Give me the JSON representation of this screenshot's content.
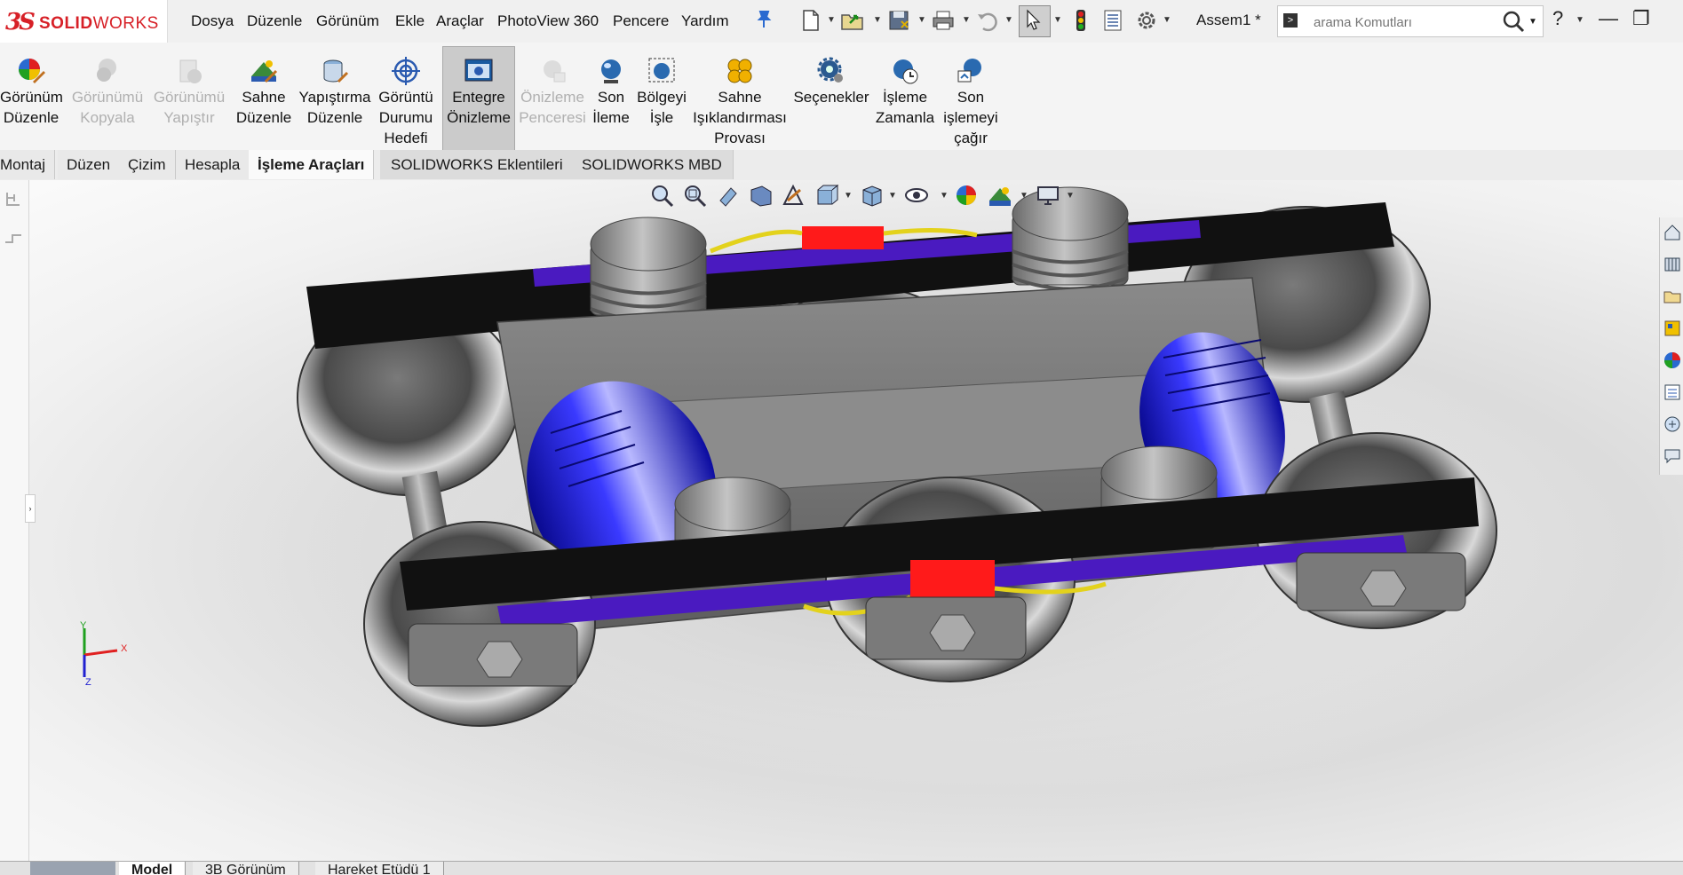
{
  "app": {
    "logo_mark": "3S",
    "logo_text_bold": "SOLID",
    "logo_text_light": "WORKS",
    "document_title": "Assem1 *"
  },
  "menu": [
    "Dosya",
    "Düzenle",
    "Görünüm",
    "Ekle",
    "Araçlar",
    "PhotoView 360",
    "Pencere",
    "Yardım"
  ],
  "search": {
    "placeholder": "arama Komutları",
    "prompt_glyph": ">"
  },
  "window_controls": {
    "help": "?",
    "minimize": "—",
    "restore": "❐",
    "close": "✕"
  },
  "ribbon": [
    {
      "label": "Görünüm Düzenle",
      "lines": [
        "Görünüm",
        "Düzenle"
      ],
      "enabled": true,
      "icon": "edit-appearance-icon"
    },
    {
      "label": "Görünümü Kopyala",
      "lines": [
        "Görünümü",
        "Kopyala"
      ],
      "enabled": false,
      "icon": "copy-appearance-icon"
    },
    {
      "label": "Görünümü Yapıştır",
      "lines": [
        "Görünümü",
        "Yapıştır"
      ],
      "enabled": false,
      "icon": "paste-appearance-icon"
    },
    {
      "label": "Sahne Düzenle",
      "lines": [
        "Sahne",
        "Düzenle"
      ],
      "enabled": true,
      "icon": "edit-scene-icon"
    },
    {
      "label": "Yapıştırma Düzenle",
      "lines": [
        "Yapıştırma",
        "Düzenle"
      ],
      "enabled": true,
      "icon": "edit-decal-icon"
    },
    {
      "label": "Görüntü Durumu Hedefi",
      "lines": [
        "Görüntü",
        "Durumu",
        "Hedefi"
      ],
      "enabled": true,
      "icon": "display-state-target-icon"
    },
    {
      "label": "Entegre Önizleme",
      "lines": [
        "Entegre",
        "Önizleme"
      ],
      "enabled": true,
      "active": true,
      "icon": "integrated-preview-icon"
    },
    {
      "label": "Önizleme Penceresi",
      "lines": [
        "Önizleme",
        "Penceresi"
      ],
      "enabled": false,
      "icon": "preview-window-icon"
    },
    {
      "label": "Son İleme",
      "lines": [
        "Son",
        "İleme"
      ],
      "enabled": true,
      "icon": "final-render-icon"
    },
    {
      "label": "Bölgeyi İşle",
      "lines": [
        "Bölgeyi",
        "İşle"
      ],
      "enabled": true,
      "icon": "render-region-icon"
    },
    {
      "label": "Sahne Işıklandırması Provası",
      "lines": [
        "Sahne",
        "Işıklandırması",
        "Provası"
      ],
      "enabled": true,
      "icon": "scene-lighting-proof-icon"
    },
    {
      "label": "Seçenekler",
      "lines": [
        "Seçenekler"
      ],
      "enabled": true,
      "icon": "options-icon"
    },
    {
      "label": "İşleme Zamanla",
      "lines": [
        "İşleme",
        "Zamanla"
      ],
      "enabled": true,
      "icon": "schedule-render-icon"
    },
    {
      "label": "Son işlemeyi çağır",
      "lines": [
        "Son",
        "işlemeyi",
        "çağır"
      ],
      "enabled": true,
      "icon": "recall-last-render-icon"
    }
  ],
  "tabs": [
    {
      "label": "Montaj",
      "selected": false
    },
    {
      "label": "Düzen",
      "selected": false
    },
    {
      "label": "Çizim",
      "selected": false
    },
    {
      "label": "Hesapla",
      "selected": false
    },
    {
      "label": "İşleme Araçları",
      "selected": true
    },
    {
      "label": "SOLIDWORKS Eklentileri",
      "selected": false
    },
    {
      "label": "SOLIDWORKS MBD",
      "selected": false
    }
  ],
  "bottom_tabs": [
    {
      "label": "Model",
      "selected": true
    },
    {
      "label": "3B Görünüm",
      "selected": false
    },
    {
      "label": "Hareket Etüdü 1",
      "selected": false
    }
  ],
  "triad": {
    "x": "X",
    "y": "Y",
    "z": "Z"
  },
  "colors": {
    "brand": "#d72027",
    "motor_blue": "#1a1ad6",
    "rail_purple": "#5a21c9",
    "red_block": "#ff1a1a",
    "cable_yellow": "#e3d21c"
  }
}
